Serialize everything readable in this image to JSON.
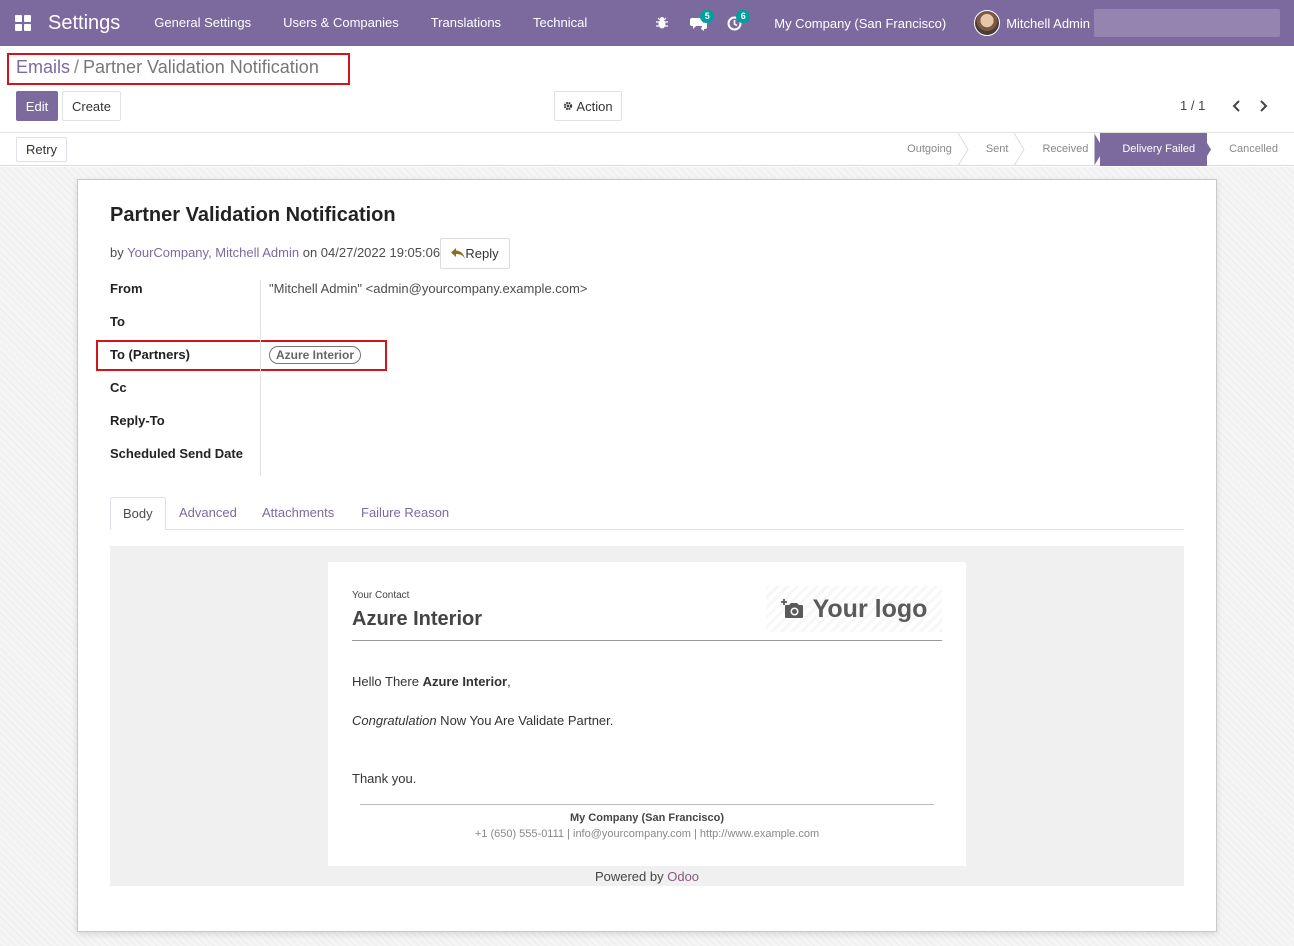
{
  "navbar": {
    "app_title": "Settings",
    "menu": [
      "General Settings",
      "Users & Companies",
      "Translations",
      "Technical"
    ],
    "messages_count": "5",
    "activities_count": "6",
    "company": "My Company (San Francisco)",
    "user": "Mitchell Admin"
  },
  "breadcrumb": {
    "parent": "Emails",
    "separator": "/",
    "current": "Partner Validation Notification"
  },
  "toolbar": {
    "edit_label": "Edit",
    "create_label": "Create",
    "action_label": "Action",
    "pager": "1 / 1"
  },
  "statusbar": {
    "retry_label": "Retry",
    "steps": [
      "Outgoing",
      "Sent",
      "Received",
      "Delivery Failed",
      "Cancelled"
    ],
    "active_step": "Delivery Failed"
  },
  "record": {
    "subject": "Partner Validation Notification",
    "by_prefix": "by",
    "authors": "YourCompany, Mitchell Admin",
    "date_text": "on 04/27/2022 19:05:06",
    "reply_label": "Reply",
    "fields": {
      "from_label": "From",
      "from_value": "\"Mitchell Admin\" <admin@yourcompany.example.com>",
      "to_label": "To",
      "to_partners_label": "To (Partners)",
      "to_partners_value": "Azure Interior",
      "cc_label": "Cc",
      "reply_to_label": "Reply-To",
      "scheduled_label": "Scheduled Send Date"
    },
    "tabs": [
      "Body",
      "Advanced",
      "Attachments",
      "Failure Reason"
    ]
  },
  "email_body": {
    "your_contact": "Your Contact",
    "contact_name": "Azure Interior",
    "logo_text": "Your logo",
    "greeting_prefix": "Hello There",
    "greeting_name": "Azure Interior",
    "greeting_suffix": ",",
    "congrats_em": "Congratulation",
    "congrats_rest": " Now You Are Validate Partner.",
    "thanks": "Thank you.",
    "footer_company": "My Company (San Francisco)",
    "footer_contact": "+1 (650) 555-0111 | info@yourcompany.com | http://www.example.com",
    "powered_by": "Powered by",
    "powered_brand": "Odoo"
  }
}
